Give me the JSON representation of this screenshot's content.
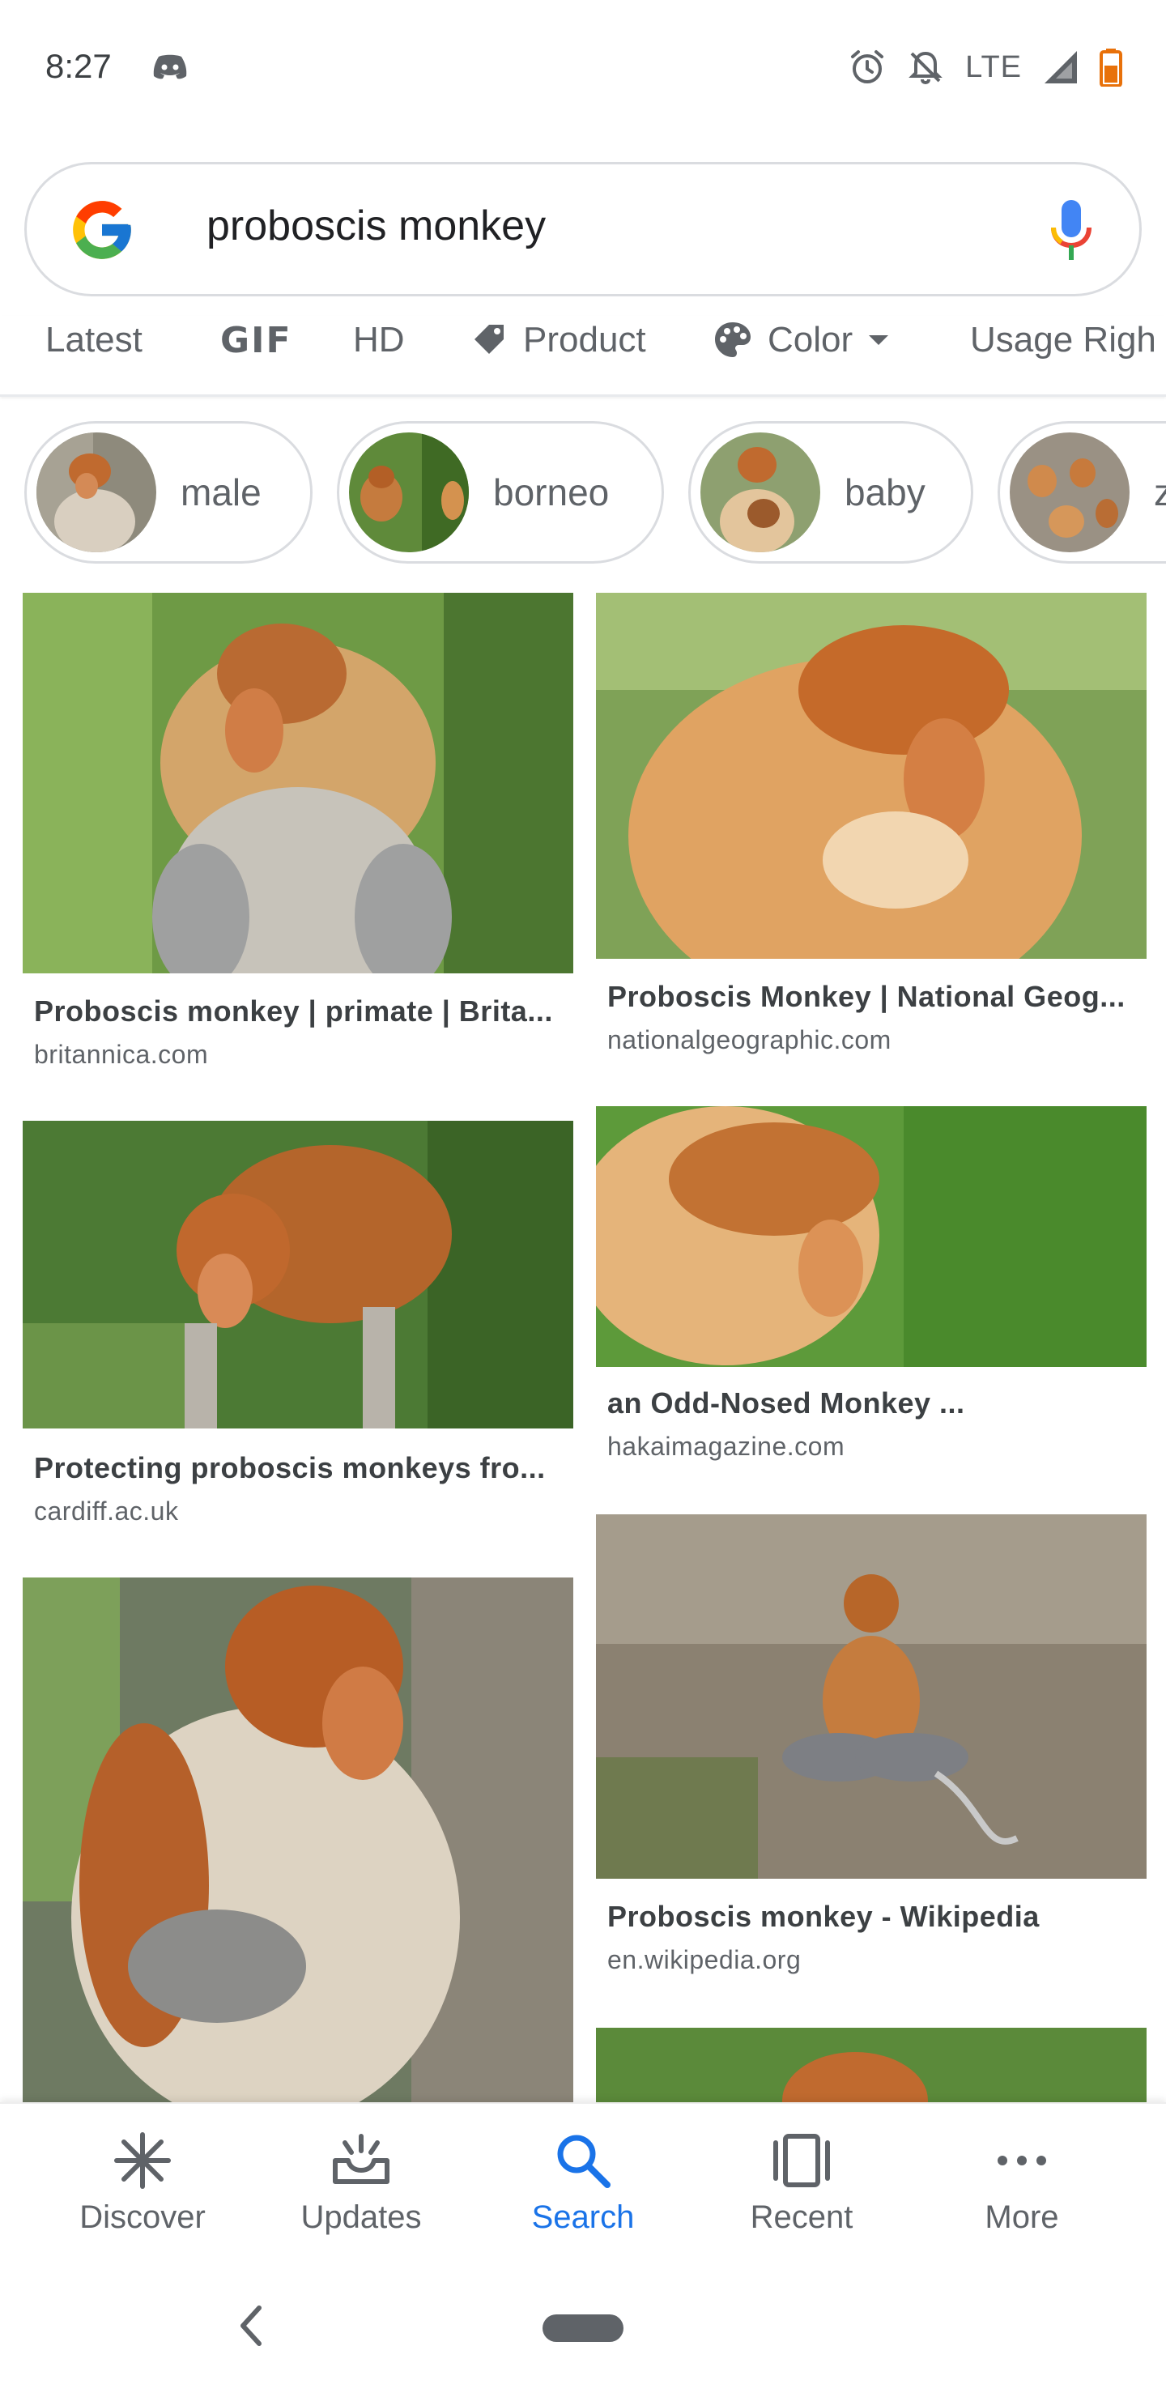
{
  "status": {
    "time": "8:27",
    "network": "LTE"
  },
  "search": {
    "query": "proboscis monkey"
  },
  "filters": [
    {
      "label": "Latest",
      "icon": "none"
    },
    {
      "label": "GIF",
      "icon": "gif-text"
    },
    {
      "label": "HD",
      "icon": "none"
    },
    {
      "label": "Product",
      "icon": "tag-icon"
    },
    {
      "label": "Color",
      "icon": "palette-icon"
    },
    {
      "label": "Usage Righ",
      "icon": "none"
    }
  ],
  "chips": [
    {
      "label": "male"
    },
    {
      "label": "borneo"
    },
    {
      "label": "baby"
    },
    {
      "label": "z"
    }
  ],
  "results": [
    {
      "title": "Proboscis monkey | primate | Brita...",
      "domain": "britannica.com"
    },
    {
      "title": "Proboscis Monkey | National Geog...",
      "domain": "nationalgeographic.com"
    },
    {
      "title": "Protecting proboscis monkeys fro...",
      "domain": "cardiff.ac.uk"
    },
    {
      "title": "an Odd-Nosed Monkey ...",
      "domain": "hakaimagazine.com"
    },
    {
      "title": "Proboscis monkey - Wikipedia",
      "domain": "en.wikipedia.org"
    }
  ],
  "nav": {
    "items": [
      {
        "label": "Discover",
        "icon": "asterisk-icon"
      },
      {
        "label": "Updates",
        "icon": "inbox-sparkle-icon"
      },
      {
        "label": "Search",
        "icon": "search-icon"
      },
      {
        "label": "Recent",
        "icon": "recent-cards-icon"
      },
      {
        "label": "More",
        "icon": "more-dots-icon"
      }
    ],
    "active": "Search"
  },
  "colors": {
    "accent": "#1a73e8",
    "text": "#202124",
    "muted": "#5f6368",
    "border": "#dadce0"
  }
}
